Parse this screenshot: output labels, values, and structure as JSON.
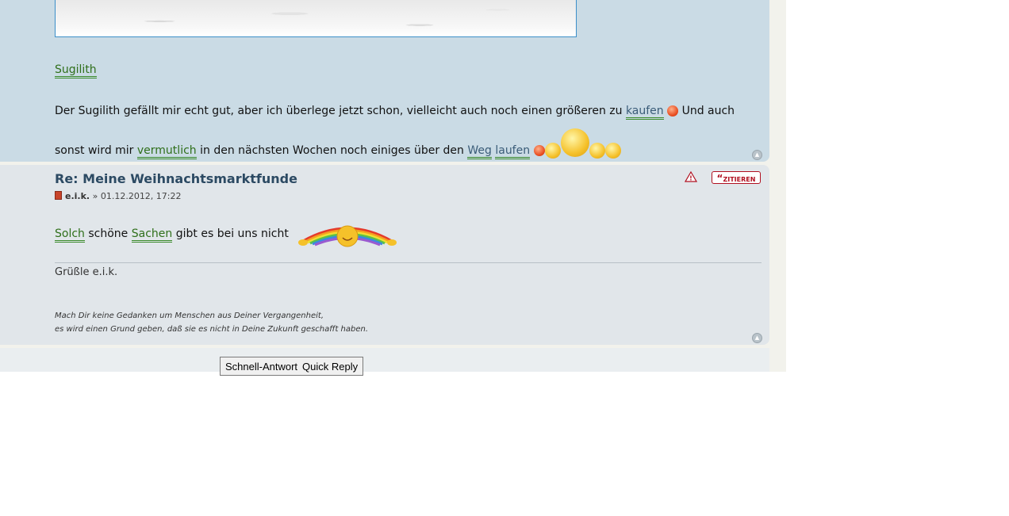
{
  "post1": {
    "keyword_title": "Sugilith",
    "text": {
      "p1": "Der Sugilith gefällt mir echt gut, aber ich überlege jetzt schon, vielleicht auch noch einen größeren zu",
      "kw1": "kaufen",
      "p2": "Und auch sonst wird mir",
      "kw2": "vermutlich",
      "p3": "in den nächsten Wochen noch einiges über den",
      "kw3": "Weg",
      "kw4": "laufen"
    }
  },
  "post2": {
    "title": "Re: Meine Weihnachtsmarktfunde",
    "author": "e.i.k.",
    "separator": "»",
    "date": "01.12.2012, 17:22",
    "quote_label": "ZITIEREN",
    "report_label": "!",
    "text": {
      "kw1": "Solch",
      "p1": "schöne",
      "kw2": "Sachen",
      "p2": "gibt es bei uns nicht"
    },
    "greeting": "Grüßle e.i.k.",
    "signature_line1": "Mach Dir keine Gedanken um Menschen aus Deiner Vergangenheit,",
    "signature_line2": "es wird einen Grund geben, daß sie es nicht in Deine Zukunft geschafft haben."
  },
  "quick_reply": {
    "label_de": "Schnell-Antwort",
    "label_en": "Quick Reply"
  },
  "icons": {
    "top": "back-to-top-icon",
    "smiley": "smiley-icon",
    "rainbow": "rainbow-smiley-icon"
  },
  "colors": {
    "post1_bg": "#cadbe5",
    "post2_bg": "#e1e6ea",
    "keyword_green": "#2f6f1a",
    "title_blue": "#2c4a63",
    "quote_red": "#b01020"
  }
}
